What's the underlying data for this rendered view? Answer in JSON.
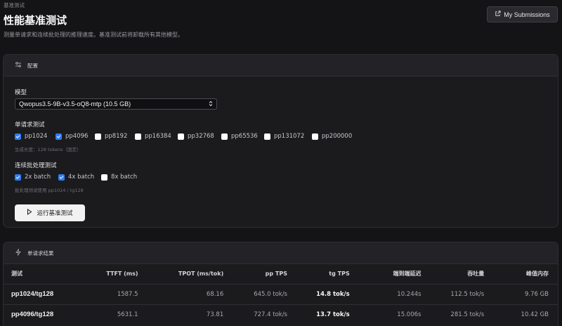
{
  "header": {
    "breadcrumb": "基准测试",
    "title": "性能基准测试",
    "subtitle": "测量单请求和连续批处理的推理速度。基准测试前将卸载所有其他模型。",
    "submissions_label": "My Submissions"
  },
  "config": {
    "heading": "配置",
    "model_label": "模型",
    "model_value": "Qwopus3.5-9B-v3.5-oQ8-mtp (10.5 GB)",
    "single_label": "单请求测试",
    "single_options": [
      {
        "label": "pp1024",
        "checked": true
      },
      {
        "label": "pp4096",
        "checked": true
      },
      {
        "label": "pp8192",
        "checked": false
      },
      {
        "label": "pp16384",
        "checked": false
      },
      {
        "label": "pp32768",
        "checked": false
      },
      {
        "label": "pp65536",
        "checked": false
      },
      {
        "label": "pp131072",
        "checked": false
      },
      {
        "label": "pp200000",
        "checked": false
      }
    ],
    "single_hint": "生成长度：128 tokens（固定）",
    "batch_label": "连续批处理测试",
    "batch_options": [
      {
        "label": "2x batch",
        "checked": true
      },
      {
        "label": "4x batch",
        "checked": true
      },
      {
        "label": "8x batch",
        "checked": false
      }
    ],
    "batch_hint": "批处理测试使用 pp1024 / tg128",
    "run_label": "运行基准测试"
  },
  "results": {
    "heading": "单请求结果",
    "columns": [
      "测试",
      "TTFT (ms)",
      "TPOT (ms/tok)",
      "pp TPS",
      "tg TPS",
      "端到端延迟",
      "吞吐量",
      "峰值内存"
    ],
    "rows": [
      [
        "pp1024/tg128",
        "1587.5",
        "68.16",
        "645.0 tok/s",
        "14.8 tok/s",
        "10.244s",
        "112.5 tok/s",
        "9.76 GB"
      ],
      [
        "pp4096/tg128",
        "5631.1",
        "73.81",
        "727.4 tok/s",
        "13.7 tok/s",
        "15.006s",
        "281.5 tok/s",
        "10.42 GB"
      ]
    ]
  }
}
